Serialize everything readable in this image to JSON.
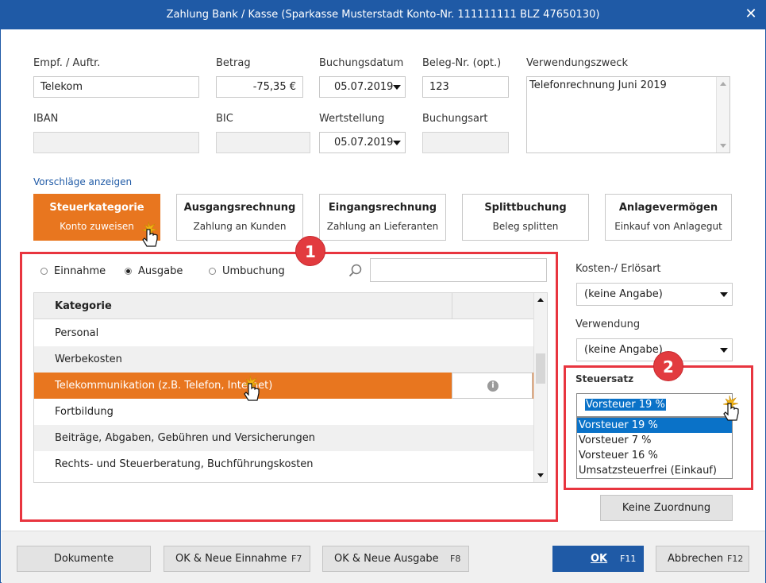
{
  "window": {
    "title": "Zahlung Bank / Kasse (Sparkasse Musterstadt Konto-Nr. 111111111  BLZ 47650130)",
    "close_glyph": "✕"
  },
  "form": {
    "empf_label": "Empf. / Auftr.",
    "empf_value": "Telekom",
    "betrag_label": "Betrag",
    "betrag_value": "-75,35 €",
    "buchungsdatum_label": "Buchungsdatum",
    "buchungsdatum_value": "05.07.2019",
    "belegnr_label": "Beleg-Nr. (opt.)",
    "belegnr_value": "123",
    "verwendungszweck_label": "Verwendungszweck",
    "verwendungszweck_value": "Telefonrechnung Juni 2019",
    "iban_label": "IBAN",
    "bic_label": "BIC",
    "wertstellung_label": "Wertstellung",
    "wertstellung_value": "05.07.2019",
    "buchungsart_label": "Buchungsart"
  },
  "suggestions_link": "Vorschläge anzeigen",
  "tiles": [
    {
      "title": "Steuerkategorie",
      "subtitle": "Konto zuweisen"
    },
    {
      "title": "Ausgangsrechnung",
      "subtitle": "Zahlung an Kunden"
    },
    {
      "title": "Eingangsrechnung",
      "subtitle": "Zahlung an Lieferanten"
    },
    {
      "title": "Splittbuchung",
      "subtitle": "Beleg splitten"
    },
    {
      "title": "Anlagevermögen",
      "subtitle": "Einkauf von Anlagegut"
    }
  ],
  "badges": {
    "one": "1",
    "two": "2"
  },
  "radios": {
    "einnahme": "Einnahme",
    "ausgabe": "Ausgabe",
    "umbuchung": "Umbuchung",
    "selected": "Ausgabe"
  },
  "grid": {
    "header": "Kategorie",
    "rows": [
      "Personal",
      "Werbekosten",
      "Telekommunikation (z.B. Telefon, Internet)",
      "Fortbildung",
      "Beiträge, Abgaben, Gebühren und Versicherungen",
      "Rechts- und Steuerberatung, Buchführungskosten"
    ],
    "info_glyph": "i"
  },
  "right": {
    "kosten_label": "Kosten-/ Erlösart",
    "kosten_value": "(keine Angabe)",
    "verwendung_label": "Verwendung",
    "verwendung_value": "(keine Angabe)",
    "steuersatz_label": "Steuersatz",
    "steuersatz_value": "Vorsteuer 19 %",
    "steuersatz_options": [
      "Vorsteuer 19 %",
      "Vorsteuer 7 %",
      "Vorsteuer 16 %",
      "Umsatzsteuerfrei (Einkauf)"
    ],
    "keine_zuordnung": "Keine Zuordnung"
  },
  "footer": {
    "dokumente": "Dokumente",
    "ok_einnahme": "OK & Neue Einnahme",
    "ok_einnahme_key": "F7",
    "ok_ausgabe": "OK & Neue Ausgabe",
    "ok_ausgabe_key": "F8",
    "ok": "OK",
    "ok_key": "F11",
    "abbrechen": "Abbrechen",
    "abbrechen_key": "F12"
  },
  "colors": {
    "accent_orange": "#e8761f",
    "title_blue": "#1f5aa6",
    "annotation_red": "#e8353f",
    "selection_blue": "#0a72c8"
  }
}
